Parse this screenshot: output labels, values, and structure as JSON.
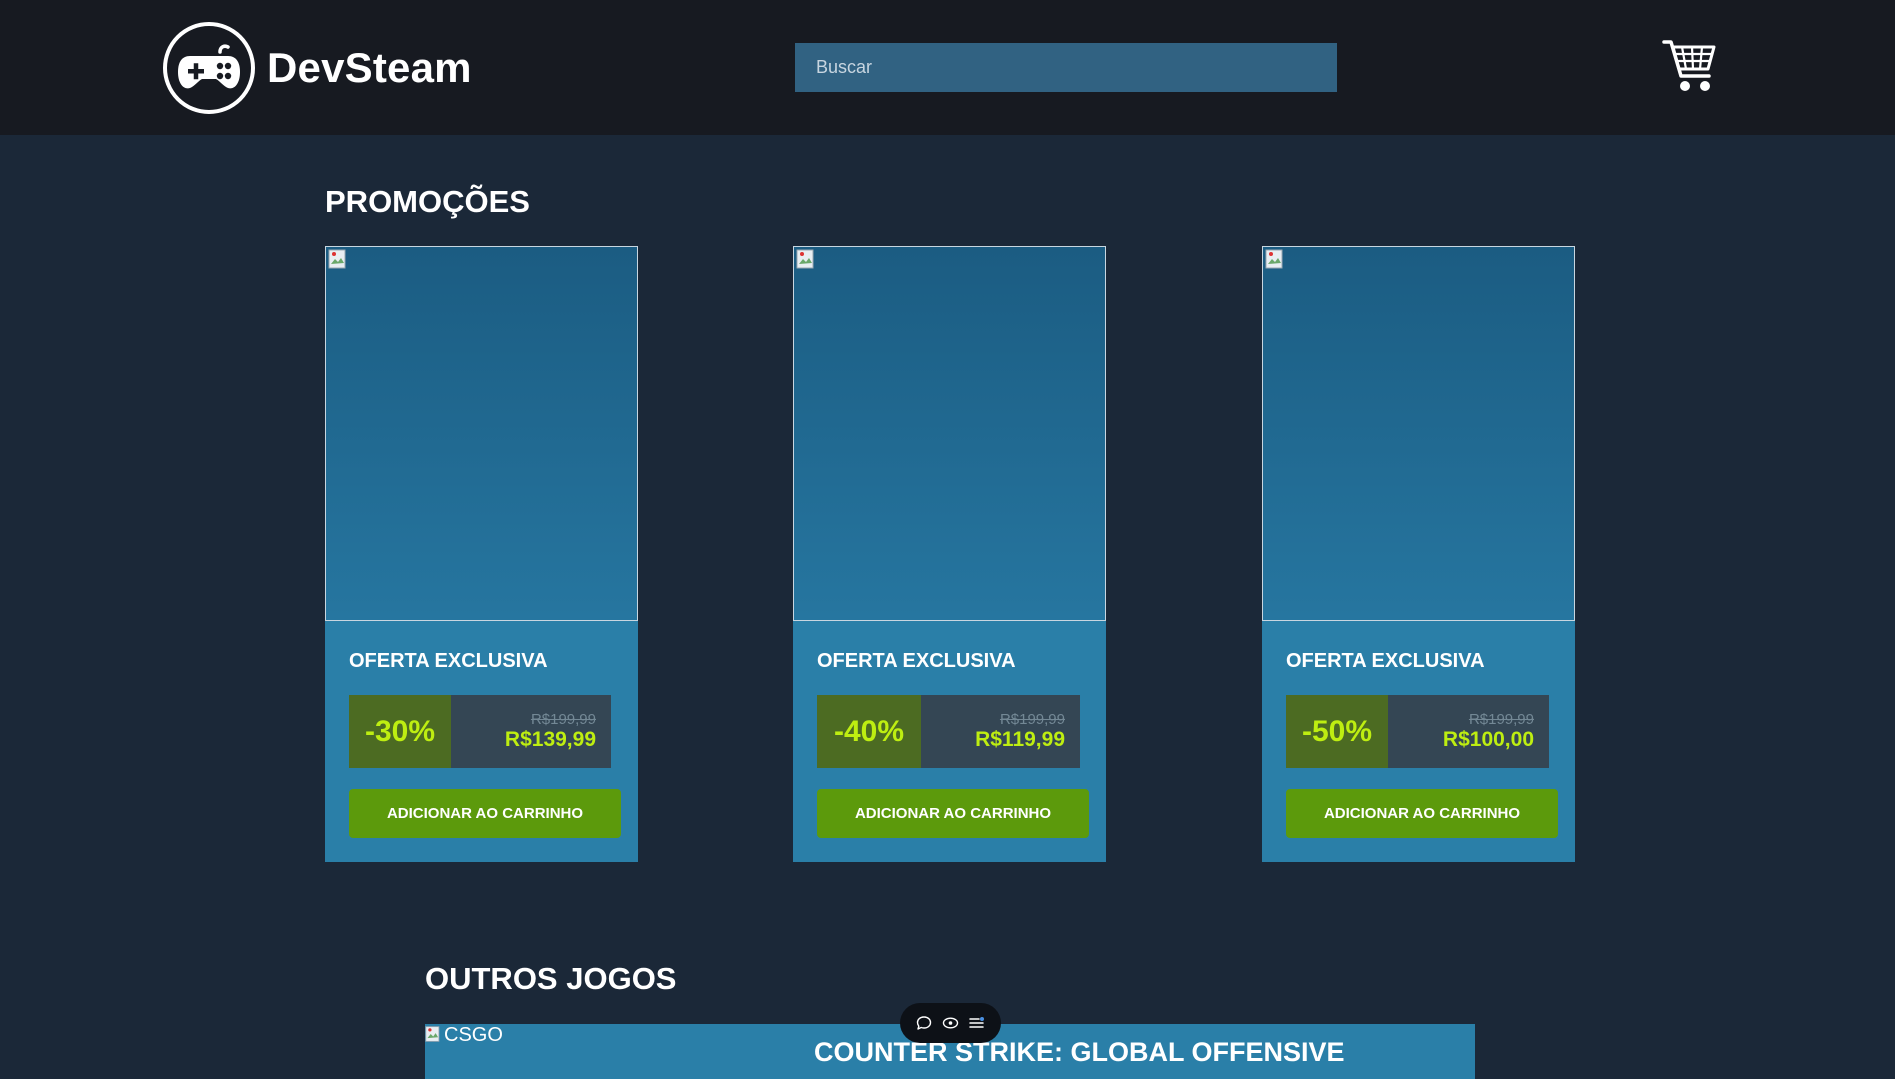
{
  "header": {
    "logo_text": "DevSteam",
    "logo_icon": "gamepad-icon",
    "search_placeholder": "Buscar",
    "cart_icon": "cart-icon"
  },
  "promocoes": {
    "title": "PROMOÇÕES",
    "cards": [
      {
        "label": "OFERTA EXCLUSIVA",
        "discount": "-30%",
        "old_price": "R$199,99",
        "new_price": "R$139,99",
        "button": "ADICIONAR AO CARRINHO"
      },
      {
        "label": "OFERTA EXCLUSIVA",
        "discount": "-40%",
        "old_price": "R$199,99",
        "new_price": "R$119,99",
        "button": "ADICIONAR AO CARRINHO"
      },
      {
        "label": "OFERTA EXCLUSIVA",
        "discount": "-50%",
        "old_price": "R$199,99",
        "new_price": "R$100,00",
        "button": "ADICIONAR AO CARRINHO"
      }
    ]
  },
  "outros_jogos": {
    "title": "OUTROS JOGOS",
    "games": [
      {
        "img_alt": "CSGO",
        "name": "COUNTER STRIKE: GLOBAL OFFENSIVE"
      }
    ]
  },
  "toolbar": {
    "icons": [
      "comment-icon",
      "eye-icon",
      "list-settings-icon"
    ]
  },
  "colors": {
    "page_bg": "#1b2838",
    "header_bg": "#171a21",
    "card_bg": "#2a7fa8",
    "discount_bg": "#4c6b22",
    "discount_text": "#beee11",
    "button_bg": "#5c9a0c",
    "search_bg": "#316282"
  }
}
